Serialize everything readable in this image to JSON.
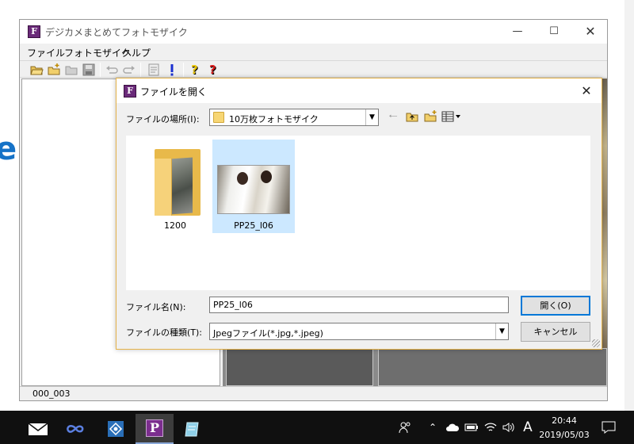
{
  "main_window": {
    "title": "デジカメまとめてフォトモザイク",
    "app_icon_letter": "F",
    "menu": [
      "ファイル",
      "フォトモザイク",
      "ヘルプ"
    ],
    "status": "000_003"
  },
  "dialog": {
    "title": "ファイルを開く",
    "icon_letter": "F",
    "look_in_label": "ファイルの場所(I):",
    "look_in_value": "10万枚フォトモザイク",
    "files": [
      {
        "name": "1200",
        "type": "folder",
        "selected": false
      },
      {
        "name": "PP25_l06",
        "type": "image",
        "selected": true
      }
    ],
    "filename_label": "ファイル名(N):",
    "filename_value": "PP25_l06",
    "filetype_label": "ファイルの種類(T):",
    "filetype_value": "Jpegファイル(*.jpg,*.jpeg)",
    "open_button": "開く(O)",
    "cancel_button": "キャンセル"
  },
  "taskbar": {
    "time": "20:44",
    "date": "2019/05/03",
    "ime": "A",
    "pinned_app_letter": "P"
  }
}
